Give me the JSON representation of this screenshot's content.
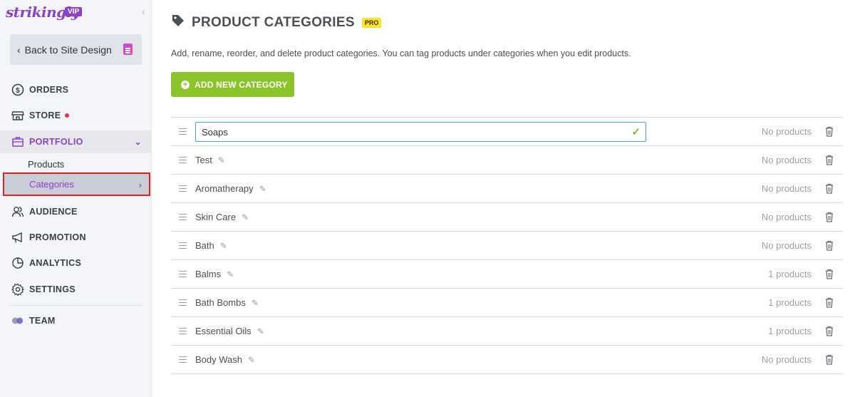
{
  "brand": {
    "name": "strikingly",
    "badge": "VIP"
  },
  "sidebar": {
    "back_label": "Back to Site Design",
    "nav": [
      {
        "label": "ORDERS",
        "icon": "dollar-circle-icon"
      },
      {
        "label": "STORE",
        "icon": "storefront-icon",
        "has_dot": true
      },
      {
        "label": "PORTFOLIO",
        "icon": "briefcase-icon",
        "active": true
      },
      {
        "label": "AUDIENCE",
        "icon": "users-icon"
      },
      {
        "label": "PROMOTION",
        "icon": "megaphone-icon"
      },
      {
        "label": "ANALYTICS",
        "icon": "pie-chart-icon"
      },
      {
        "label": "SETTINGS",
        "icon": "gear-icon"
      },
      {
        "label": "TEAM",
        "icon": "team-icon"
      }
    ],
    "sub_items": [
      {
        "label": "Products"
      },
      {
        "label": "Categories",
        "selected": true
      }
    ]
  },
  "main": {
    "title": "PRODUCT CATEGORIES",
    "badge": "PRO",
    "description": "Add, rename, reorder, and delete product categories. You can tag products under categories when you edit products.",
    "add_button": "ADD NEW CATEGORY",
    "editing_value": "Soaps",
    "categories": [
      {
        "name": "Soaps",
        "count": "No products",
        "editing": true
      },
      {
        "name": "Test",
        "count": "No products"
      },
      {
        "name": "Aromatherapy",
        "count": "No products"
      },
      {
        "name": "Skin Care",
        "count": "No products"
      },
      {
        "name": "Bath",
        "count": "No products"
      },
      {
        "name": "Balms",
        "count": "1 products"
      },
      {
        "name": "Bath Bombs",
        "count": "1 products"
      },
      {
        "name": "Essential Oils",
        "count": "1 products"
      },
      {
        "name": "Body Wash",
        "count": "No products"
      }
    ]
  },
  "colors": {
    "accent": "#8b41c9",
    "add_button": "#8bc42a",
    "pro_badge": "#ffe426",
    "highlight_border": "#e0201b"
  }
}
